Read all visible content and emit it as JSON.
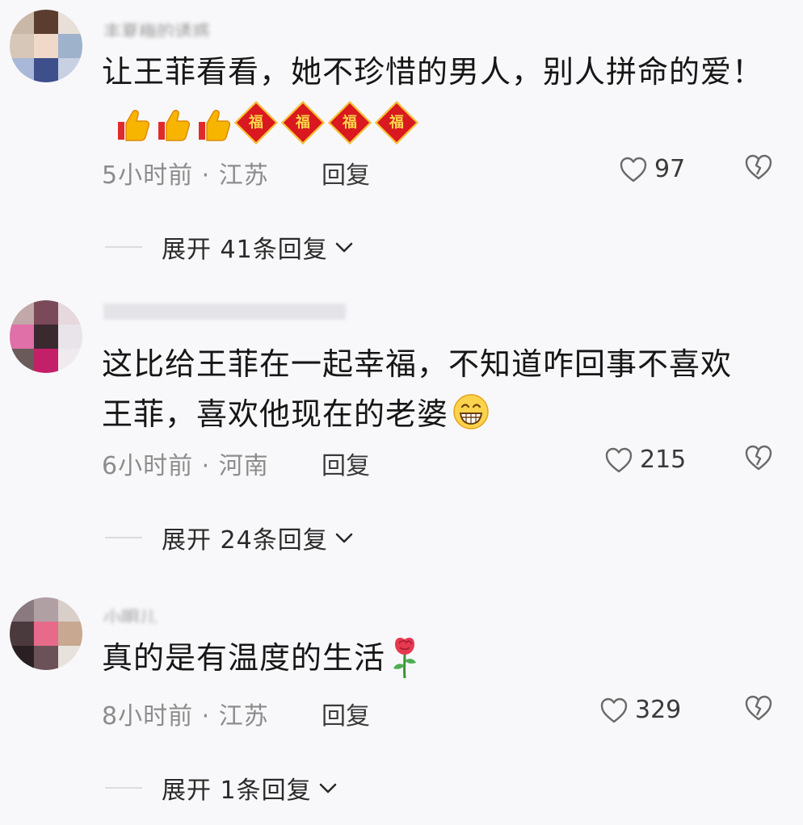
{
  "comments": [
    {
      "username": "丰夏梅的诱惑",
      "text": "让王菲看看，她不珍惜的男人，别人拼命的爱！",
      "fu_glyph": "福",
      "time_location": "5小时前 · 江苏",
      "reply_label": "回复",
      "likes": "97",
      "expand_label": "展开 41条回复"
    },
    {
      "username": "小吊",
      "text_line1": "这比给王菲在一起幸福，不知道咋回事不喜欢",
      "text_line2": "王菲，喜欢他现在的老婆",
      "time_location": "6小时前 · 河南",
      "reply_label": "回复",
      "likes": "215",
      "expand_label": "展开 24条回复"
    },
    {
      "username": "小明儿",
      "text": "真的是有温度的生活",
      "time_location": "8小时前 · 江苏",
      "reply_label": "回复",
      "likes": "329",
      "expand_label": "展开 1条回复"
    }
  ],
  "icons": {
    "like": "heart-outline-icon",
    "dislike": "broken-heart-icon",
    "expand": "chevron-down-icon",
    "thumbs_up": "thumbs-up-emoji",
    "fu": "fu-emoji",
    "grin": "grin-emoji",
    "rose": "rose-emoji"
  },
  "colors": {
    "background": "#f8f8fa",
    "text": "#161616",
    "meta": "#8c8c8c",
    "fu_red": "#d9181f",
    "fu_gold": "#f7c530"
  }
}
